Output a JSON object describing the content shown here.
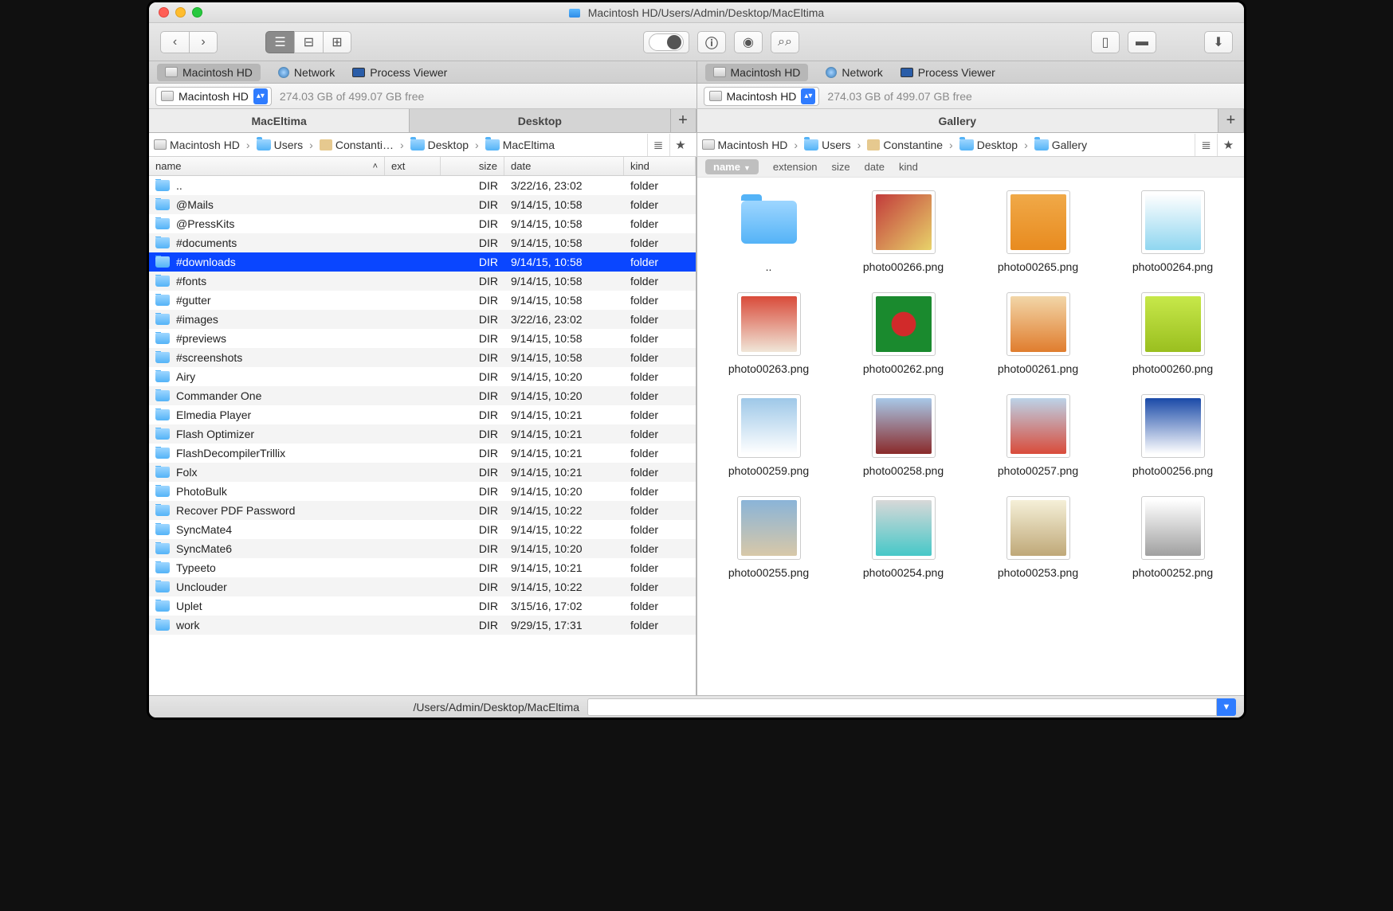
{
  "title": "Macintosh HD/Users/Admin/Desktop/MacEltima",
  "toolbar": {
    "view_modes": [
      "list",
      "columns",
      "icons"
    ],
    "active_view": 0
  },
  "panes": {
    "left": {
      "sources": [
        "Macintosh HD",
        "Network",
        "Process Viewer"
      ],
      "active_source": 0,
      "volume": "Macintosh HD",
      "freespace": "274.03 GB of 499.07 GB free",
      "tabs": [
        "MacEltima",
        "Desktop"
      ],
      "active_tab": 0,
      "crumbs": [
        "Macintosh HD",
        "Users",
        "Constanti…",
        "Desktop",
        "MacEltima"
      ],
      "columns": {
        "name": "name",
        "ext": "ext",
        "size": "size",
        "date": "date",
        "kind": "kind"
      },
      "selected_index": 4,
      "rows": [
        {
          "name": "..",
          "size": "DIR",
          "date": "3/22/16, 23:02",
          "kind": "folder"
        },
        {
          "name": "@Mails",
          "size": "DIR",
          "date": "9/14/15, 10:58",
          "kind": "folder"
        },
        {
          "name": "@PressKits",
          "size": "DIR",
          "date": "9/14/15, 10:58",
          "kind": "folder"
        },
        {
          "name": "#documents",
          "size": "DIR",
          "date": "9/14/15, 10:58",
          "kind": "folder"
        },
        {
          "name": "#downloads",
          "size": "DIR",
          "date": "9/14/15, 10:58",
          "kind": "folder"
        },
        {
          "name": "#fonts",
          "size": "DIR",
          "date": "9/14/15, 10:58",
          "kind": "folder"
        },
        {
          "name": "#gutter",
          "size": "DIR",
          "date": "9/14/15, 10:58",
          "kind": "folder"
        },
        {
          "name": "#images",
          "size": "DIR",
          "date": "3/22/16, 23:02",
          "kind": "folder"
        },
        {
          "name": "#previews",
          "size": "DIR",
          "date": "9/14/15, 10:58",
          "kind": "folder"
        },
        {
          "name": "#screenshots",
          "size": "DIR",
          "date": "9/14/15, 10:58",
          "kind": "folder"
        },
        {
          "name": "Airy",
          "size": "DIR",
          "date": "9/14/15, 10:20",
          "kind": "folder"
        },
        {
          "name": "Commander One",
          "size": "DIR",
          "date": "9/14/15, 10:20",
          "kind": "folder"
        },
        {
          "name": "Elmedia Player",
          "size": "DIR",
          "date": "9/14/15, 10:21",
          "kind": "folder"
        },
        {
          "name": "Flash Optimizer",
          "size": "DIR",
          "date": "9/14/15, 10:21",
          "kind": "folder"
        },
        {
          "name": "FlashDecompilerTrillix",
          "size": "DIR",
          "date": "9/14/15, 10:21",
          "kind": "folder"
        },
        {
          "name": "Folx",
          "size": "DIR",
          "date": "9/14/15, 10:21",
          "kind": "folder"
        },
        {
          "name": "PhotoBulk",
          "size": "DIR",
          "date": "9/14/15, 10:20",
          "kind": "folder"
        },
        {
          "name": "Recover PDF Password",
          "size": "DIR",
          "date": "9/14/15, 10:22",
          "kind": "folder"
        },
        {
          "name": "SyncMate4",
          "size": "DIR",
          "date": "9/14/15, 10:22",
          "kind": "folder"
        },
        {
          "name": "SyncMate6",
          "size": "DIR",
          "date": "9/14/15, 10:20",
          "kind": "folder"
        },
        {
          "name": "Typeeto",
          "size": "DIR",
          "date": "9/14/15, 10:21",
          "kind": "folder"
        },
        {
          "name": "Unclouder",
          "size": "DIR",
          "date": "9/14/15, 10:22",
          "kind": "folder"
        },
        {
          "name": "Uplet",
          "size": "DIR",
          "date": "3/15/16, 17:02",
          "kind": "folder"
        },
        {
          "name": "work",
          "size": "DIR",
          "date": "9/29/15, 17:31",
          "kind": "folder"
        }
      ]
    },
    "right": {
      "sources": [
        "Macintosh HD",
        "Network",
        "Process Viewer"
      ],
      "active_source": 0,
      "volume": "Macintosh HD",
      "freespace": "274.03 GB of 499.07 GB free",
      "tabs": [
        "Gallery"
      ],
      "active_tab": 0,
      "crumbs": [
        "Macintosh HD",
        "Users",
        "Constantine",
        "Desktop",
        "Gallery"
      ],
      "sort_columns": {
        "name": "name",
        "extension": "extension",
        "size": "size",
        "date": "date",
        "kind": "kind"
      },
      "items": [
        {
          "name": "..",
          "folder": true,
          "color": ""
        },
        {
          "name": "photo00266.png",
          "color": "linear-gradient(135deg,#c23b3b,#e8d36a)"
        },
        {
          "name": "photo00265.png",
          "color": "linear-gradient(#f0a948,#e88b1f)"
        },
        {
          "name": "photo00264.png",
          "color": "linear-gradient(#fefefe,#8fd6f0)"
        },
        {
          "name": "photo00263.png",
          "color": "linear-gradient(#d94b3a,#f0e6d8)"
        },
        {
          "name": "photo00262.png",
          "color": "radial-gradient(#d12a2a 30%,#1a8a2e 32%)"
        },
        {
          "name": "photo00261.png",
          "color": "linear-gradient(#f2d6a8,#e07d2e)"
        },
        {
          "name": "photo00260.png",
          "color": "linear-gradient(#c7e84a,#9abf1f)"
        },
        {
          "name": "photo00259.png",
          "color": "linear-gradient(#9ec8e8,#ffffff)"
        },
        {
          "name": "photo00258.png",
          "color": "linear-gradient(#a8c8e8,#8a2a2a)"
        },
        {
          "name": "photo00257.png",
          "color": "linear-gradient(#bcd3e8,#d94b3a)"
        },
        {
          "name": "photo00256.png",
          "color": "linear-gradient(#1a4aa8,#ffffff)"
        },
        {
          "name": "photo00255.png",
          "color": "linear-gradient(#8ab4d8,#d8c8a8)"
        },
        {
          "name": "photo00254.png",
          "color": "linear-gradient(#d8d8d8,#46c8c8)"
        },
        {
          "name": "photo00253.png",
          "color": "linear-gradient(#f5f0d8,#bfa878)"
        },
        {
          "name": "photo00252.png",
          "color": "linear-gradient(#ffffff,#a0a0a0)"
        }
      ]
    }
  },
  "status": {
    "path": "/Users/Admin/Desktop/MacEltima"
  }
}
